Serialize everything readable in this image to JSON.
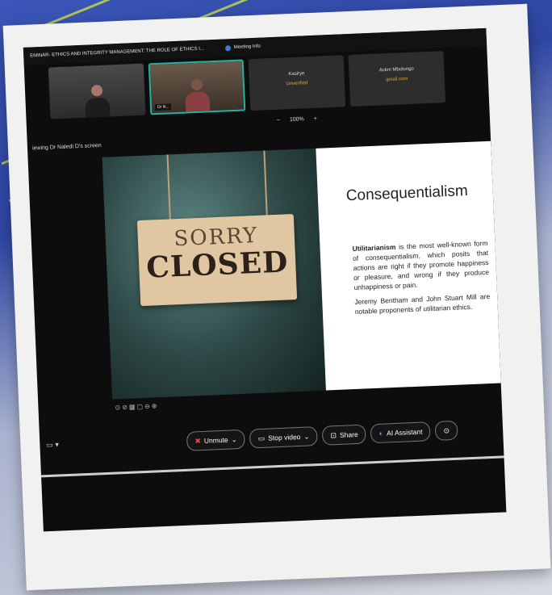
{
  "topbar": {
    "title": "EMINAR- ETHICS AND INTEGRITY MANAGEMENT: THE ROLE OF ETHICS I...",
    "meeting_info": "Meeting Info"
  },
  "tiles": [
    {
      "name": "",
      "status": "",
      "type": "video"
    },
    {
      "name": "Dr N...",
      "status": "",
      "type": "video-active"
    },
    {
      "name": "Kasirye",
      "status": "Unverified",
      "type": "text"
    },
    {
      "name": "Ackm Mbolongo",
      "status": "gmail.com",
      "type": "text"
    }
  ],
  "zoom": {
    "minus": "−",
    "level": "100%",
    "plus": "+"
  },
  "viewing": "iewing Dr Naledi D's screen",
  "slide": {
    "sign_sorry": "SORRY",
    "sign_closed": "CLOSED",
    "title": "Consequentialism",
    "bold_term": "Utilitarianism",
    "para1_rest": " is the most well-known form of consequentialism, which posits that actions are right if they promote happiness or pleasure, and wrong if they produce unhappiness or pain.",
    "para2": "Jeremy Bentham and John Stuart Mill are notable proponents of utilitarian ethics."
  },
  "controls": {
    "unmute": "Unmute",
    "stop_video": "Stop video",
    "share": "Share",
    "ai_assistant": "AI Assistant"
  },
  "colors": {
    "accent_teal": "#27b0a4",
    "mute_red": "#e24b4b",
    "status_amber": "#e0a832"
  }
}
